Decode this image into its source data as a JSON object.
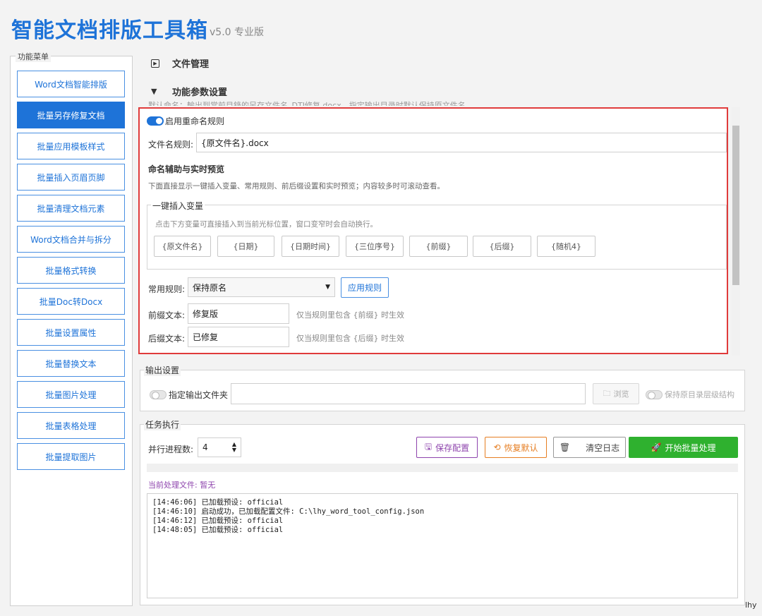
{
  "app": {
    "title": "智能文档排版工具箱",
    "version": "v5.0 专业版"
  },
  "menu": {
    "legend": "功能菜单",
    "items": [
      "Word文档智能排版",
      "批量另存修复文档",
      "批量应用模板样式",
      "批量插入页眉页脚",
      "批量清理文档元素",
      "Word文档合并与拆分",
      "批量格式转换",
      "批量Doc转Docx",
      "批量设置属性",
      "批量替换文本",
      "批量图片处理",
      "批量表格处理",
      "批量提取图片"
    ],
    "active_index": 1
  },
  "sections": {
    "file_mgmt": "文件管理",
    "params": "功能参数设置"
  },
  "partial_text": "默认命名：輸出到當前目錄的另存文件名_DTI修复.docx，指定输出目录时默认保持原文件名。",
  "params": {
    "rename_toggle_label": "启用重命名规则",
    "rename_enabled": true,
    "filename_rule_label": "文件名规则:",
    "filename_rule_value": "{原文件名}.docx",
    "assist_title": "命名辅助与实时预览",
    "assist_desc": "下面直接显示一键插入变量、常用规则、前后缀设置和实时预览；内容较多时可滚动查看。",
    "var_group_legend": "一键插入变量",
    "var_hint": "点击下方变量可直接插入到当前光标位置，窗口变窄时会自动换行。",
    "vars": [
      "{原文件名}",
      "{日期}",
      "{日期时间}",
      "{三位序号}",
      "{前缀}",
      "{后缀}",
      "{随机4}"
    ],
    "common_rule_label": "常用规则:",
    "common_rule_value": "保持原名",
    "apply_rule_label": "应用规则",
    "prefix_label": "前缀文本:",
    "prefix_value": "修复版",
    "prefix_hint": "仅当规则里包含 {前缀} 时生效",
    "suffix_label": "后缀文本:",
    "suffix_value": "已修复",
    "suffix_hint": "仅当规则里包含 {后缀} 时生效"
  },
  "output": {
    "legend": "输出设置",
    "folder_toggle_label": "指定输出文件夹",
    "folder_value": "",
    "browse_label": "浏览",
    "keep_structure_label": "保持原目录层级结构"
  },
  "task": {
    "legend": "任务执行",
    "parallel_label": "并行进程数:",
    "parallel_value": "4",
    "save_config": "保存配置",
    "restore_default": "恢复默认",
    "clear_log": "清空日志",
    "start_batch": "开始批量处理",
    "current_label": "当前处理文件: 暂无",
    "logs": [
      "[14:46:06] 已加载预设: official",
      "[14:46:10] 启动成功，已加载配置文件: C:\\lhy_word_tool_config.json",
      "[14:46:12] 已加载预设: official",
      "[14:48:05] 已加载预设: official"
    ]
  },
  "watermark": "lhy",
  "colors": {
    "accent": "#1e73d8",
    "highlight": "#e03b3b",
    "start": "#2fb12f",
    "save": "#8e44ad",
    "restore": "#e67e22"
  }
}
